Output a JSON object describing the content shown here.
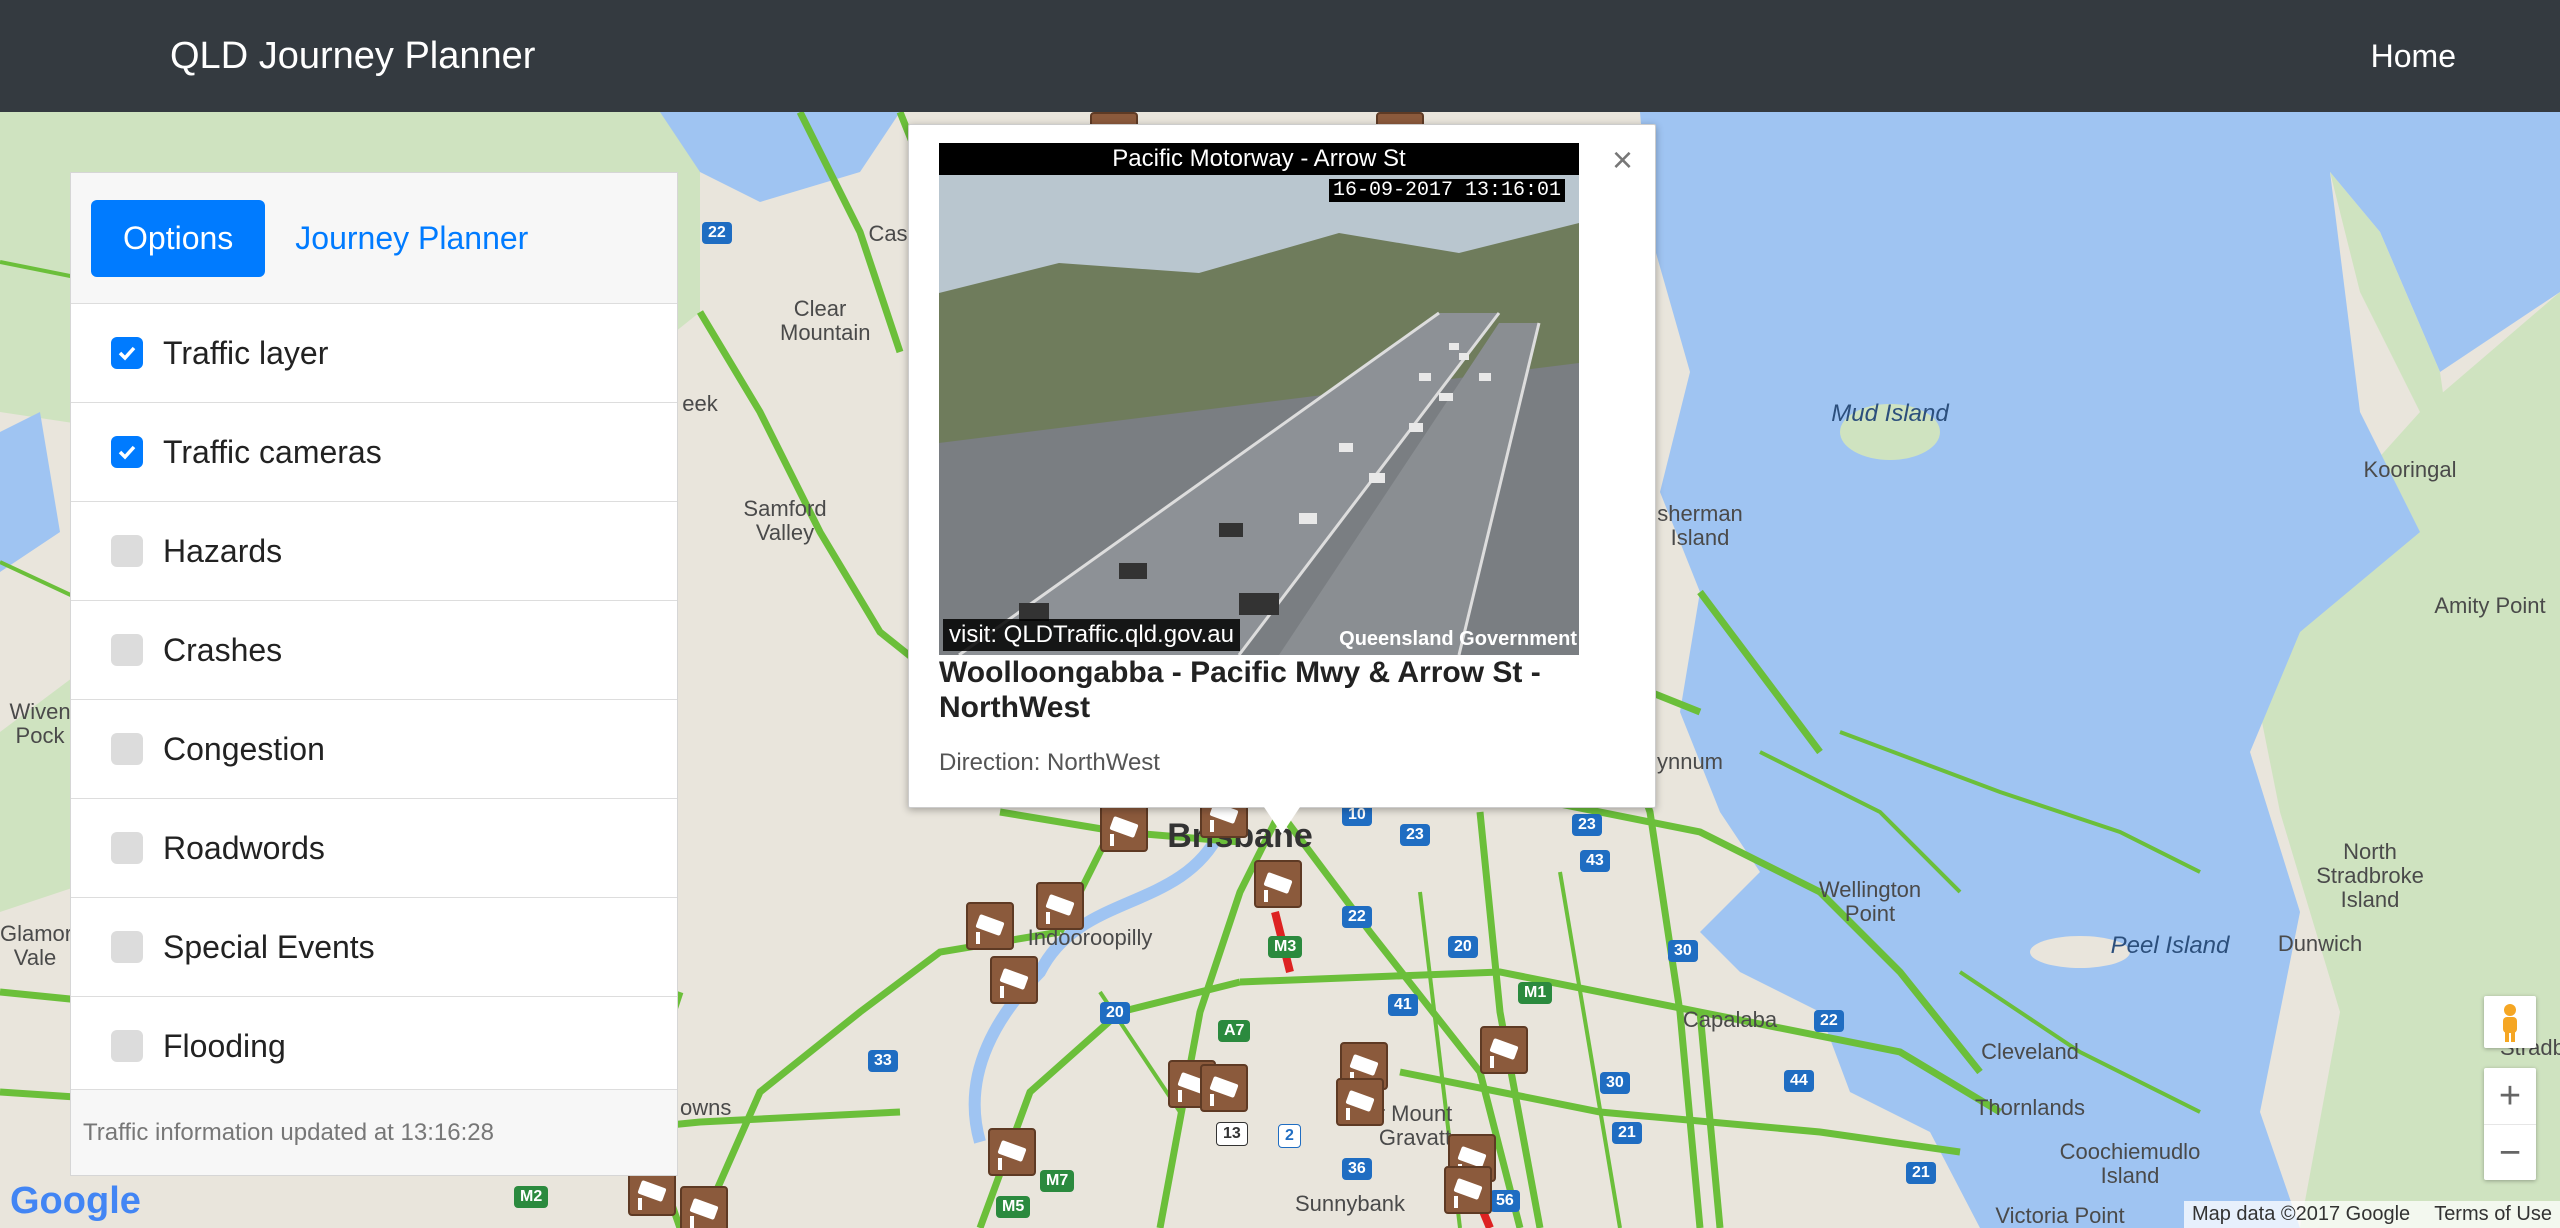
{
  "navbar": {
    "brand": "QLD Journey Planner",
    "home_label": "Home"
  },
  "sidebar": {
    "tabs": {
      "options": "Options",
      "journey_planner": "Journey Planner"
    },
    "options": [
      {
        "label": "Traffic layer",
        "checked": true
      },
      {
        "label": "Traffic cameras",
        "checked": true
      },
      {
        "label": "Hazards",
        "checked": false
      },
      {
        "label": "Crashes",
        "checked": false
      },
      {
        "label": "Congestion",
        "checked": false
      },
      {
        "label": "Roadwords",
        "checked": false
      },
      {
        "label": "Special Events",
        "checked": false
      },
      {
        "label": "Flooding",
        "checked": false
      }
    ],
    "footer": "Traffic information updated at 13:16:28"
  },
  "popup": {
    "camera_caption": "Pacific Motorway - Arrow St",
    "camera_timestamp": "16-09-2017 13:16:01",
    "camera_watermark": "visit: QLDTraffic.qld.gov.au",
    "camera_logo": "Queensland Government",
    "heading": "Woolloongabba - Pacific Mwy & Arrow St - NorthWest",
    "direction": "Direction: NorthWest",
    "close_symbol": "×"
  },
  "map": {
    "labels": {
      "clear_mountain": "Clear Mountain",
      "samford": "Samford Valley",
      "mud_island": "Mud Island",
      "kooringal": "Kooringal",
      "amity": "Amity Point",
      "fisherman": "sherman Island",
      "brisbane": "Brisbane",
      "indooroopilly": "Indooroopilly",
      "wellington": "Wellington Point",
      "peel": "Peel Island",
      "dunwich": "Dunwich",
      "north_stradbroke": "North Stradbroke Island",
      "capalaba": "Capalaba",
      "cleveland": "Cleveland",
      "thornlands": "Thornlands",
      "coochiemudlo": "Coochiemudlo Island",
      "victoria_point": "Victoria Point",
      "sunnybank": "Sunnybank",
      "mount_gravatt": "r Mount Gravatt",
      "wivenhoe": "Wiven Pock",
      "glamorgan": "Glamor Vale",
      "ynnum": "ynnum",
      "eek": "eek",
      "cas": "Cas",
      "owns": "owns",
      "stradbroke_edge": "Stradbrok"
    },
    "shields": [
      "22",
      "10",
      "23",
      "23",
      "43",
      "22",
      "20",
      "30",
      "41",
      "20",
      "M3",
      "A7",
      "13",
      "2",
      "36",
      "M7",
      "M5",
      "33",
      "M2",
      "44",
      "30",
      "21",
      "21",
      "22",
      "M1",
      "56"
    ],
    "attribution": "Map data ©2017 Google",
    "terms": "Terms of Use",
    "google_logo": "Google"
  },
  "colors": {
    "navbar": "#343a40",
    "accent": "#007bff",
    "water": "#9fc4f2",
    "road": "#6bbf3a",
    "camera": "#8b5a3c"
  }
}
